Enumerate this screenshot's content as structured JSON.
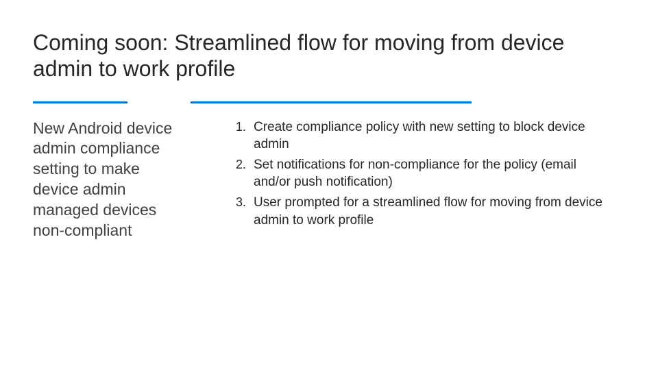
{
  "title": "Coming soon: Streamlined flow for moving from device admin to work profile",
  "subhead": "New Android device admin compliance setting to make device admin managed devices non-compliant",
  "steps": [
    "Create compliance policy with new setting to block device admin",
    "Set notifications for non-compliance for the policy (email and/or push notification)",
    "User prompted for a streamlined flow for moving from device admin to work profile"
  ]
}
